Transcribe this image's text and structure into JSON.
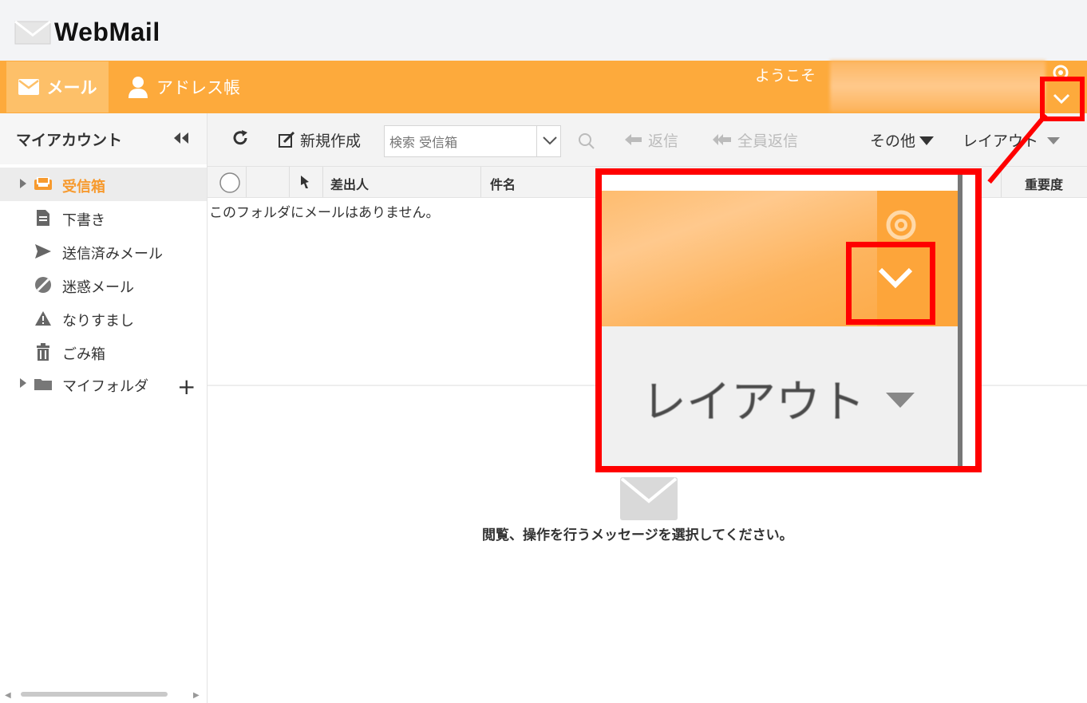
{
  "app": {
    "title": "WebMail"
  },
  "nav": {
    "mail_label": "メール",
    "address_label": "アドレス帳",
    "welcome": "ようこそ"
  },
  "sidebar": {
    "title": "マイアカウント",
    "folders": [
      {
        "label": "受信箱",
        "icon": "inbox-icon"
      },
      {
        "label": "下書き",
        "icon": "draft-icon"
      },
      {
        "label": "送信済みメール",
        "icon": "send-icon"
      },
      {
        "label": "迷惑メール",
        "icon": "spam-icon"
      },
      {
        "label": "なりすまし",
        "icon": "warning-icon"
      },
      {
        "label": "ごみ箱",
        "icon": "trash-icon"
      },
      {
        "label": "マイフォルダ",
        "icon": "folder-icon"
      }
    ]
  },
  "toolbar": {
    "new_label": "新規作成",
    "search_placeholder": "検索 受信箱",
    "reply_label": "返信",
    "reply_all_label": "全員返信",
    "more_label": "その他",
    "layout_label": "レイアウト"
  },
  "table": {
    "columns": {
      "sender": "差出人",
      "subject": "件名",
      "priority": "重要度"
    },
    "empty_message": "このフォルダにメールはありません。"
  },
  "preview": {
    "message": "閲覧、操作を行うメッセージを選択してください。"
  },
  "zoom": {
    "layout_label": "レイアウト"
  },
  "colors": {
    "accent": "#fdaa3c",
    "callout": "#ff0000",
    "active_folder": "#f79a2e"
  }
}
